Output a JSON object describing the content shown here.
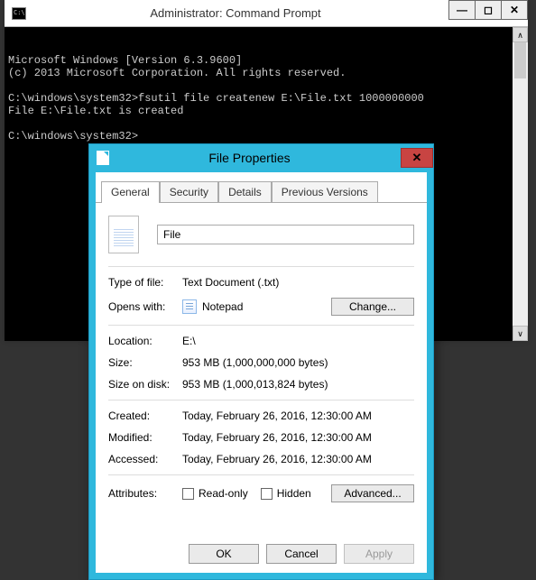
{
  "cmd": {
    "title": "Administrator: Command Prompt",
    "lines": "Microsoft Windows [Version 6.3.9600]\n(c) 2013 Microsoft Corporation. All rights reserved.\n\nC:\\windows\\system32>fsutil file createnew E:\\File.txt 1000000000\nFile E:\\File.txt is created\n\nC:\\windows\\system32>"
  },
  "props": {
    "title": "File Properties",
    "tabs": {
      "general": "General",
      "security": "Security",
      "details": "Details",
      "previous": "Previous Versions"
    },
    "file_name": "File",
    "labels": {
      "type_of_file": "Type of file:",
      "opens_with": "Opens with:",
      "location": "Location:",
      "size": "Size:",
      "size_on_disk": "Size on disk:",
      "created": "Created:",
      "modified": "Modified:",
      "accessed": "Accessed:",
      "attributes": "Attributes:"
    },
    "values": {
      "type_of_file": "Text Document (.txt)",
      "opens_with": "Notepad",
      "location": "E:\\",
      "size": "953 MB (1,000,000,000 bytes)",
      "size_on_disk": "953 MB (1,000,013,824 bytes)",
      "created": "Today, February 26, 2016, 12:30:00 AM",
      "modified": "Today, February 26, 2016, 12:30:00 AM",
      "accessed": "Today, February 26, 2016, 12:30:00 AM"
    },
    "attrs": {
      "read_only": "Read-only",
      "hidden": "Hidden"
    },
    "buttons": {
      "change": "Change...",
      "advanced": "Advanced...",
      "ok": "OK",
      "cancel": "Cancel",
      "apply": "Apply"
    }
  }
}
